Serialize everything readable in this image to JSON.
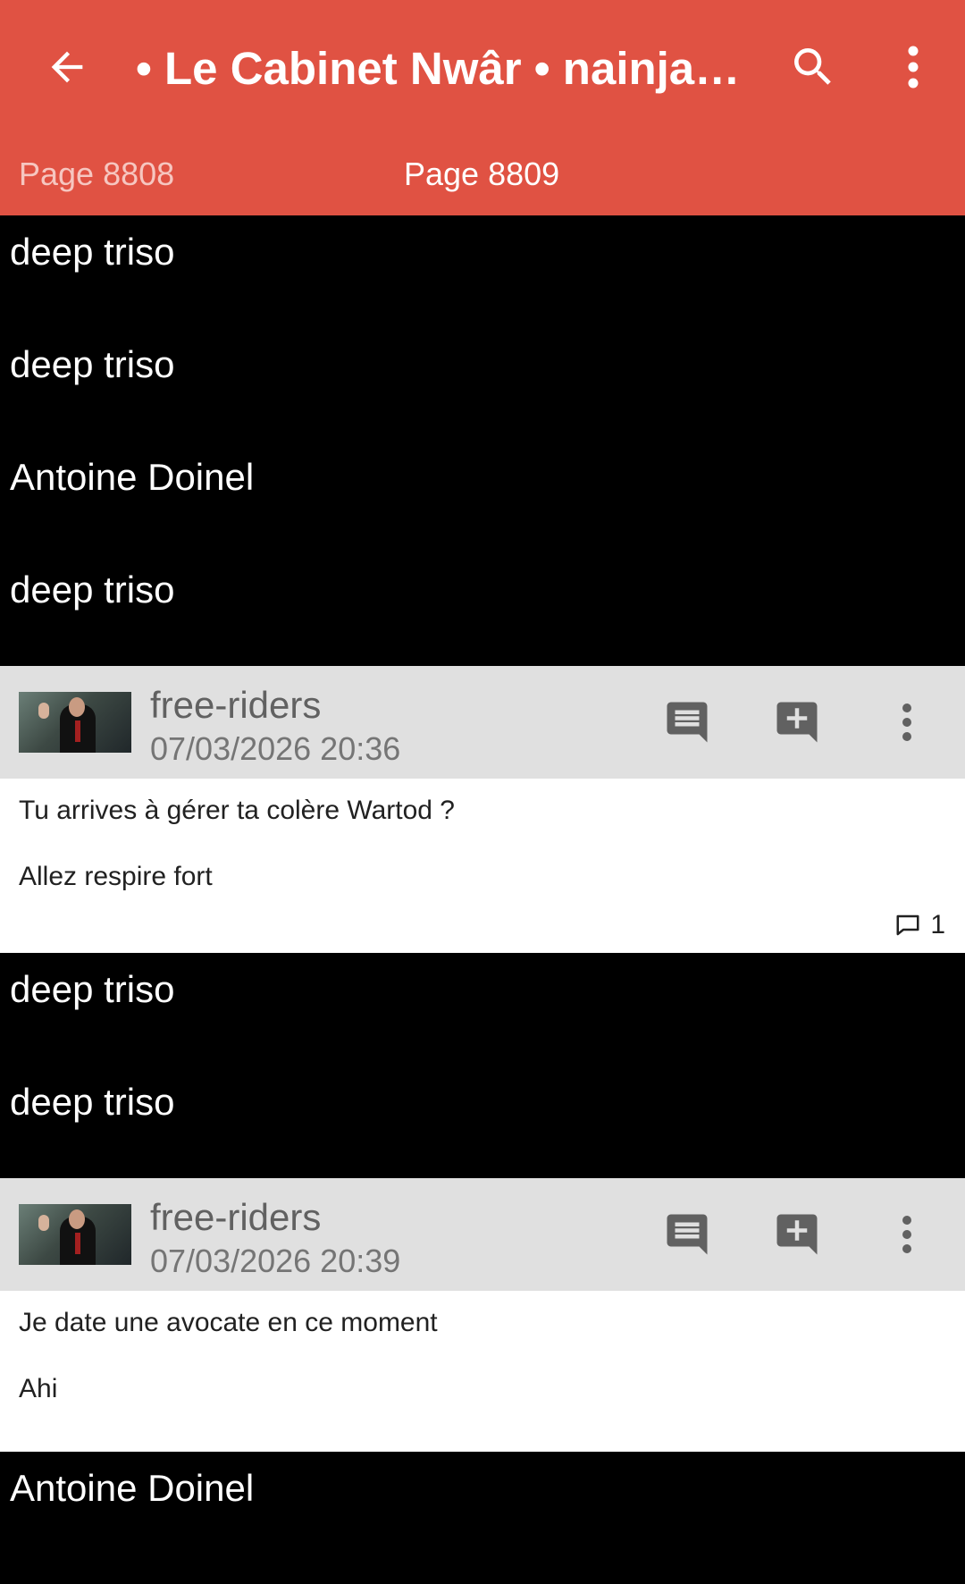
{
  "toolbar": {
    "title": "• Le Cabinet Nwâr • nainjau…",
    "back_icon": "arrow-back-icon",
    "search_icon": "search-icon",
    "menu_icon": "more-vert-icon"
  },
  "tabs": {
    "previous": "Page 8808",
    "current": "Page 8809"
  },
  "colors": {
    "appbar": "#e05243",
    "ignored_bg": "#000000",
    "post_header_bg": "#e0e0e0"
  },
  "feed": {
    "ignored_top": [
      "deep triso",
      "deep triso",
      "Antoine Doinel",
      "deep triso"
    ],
    "post1": {
      "author": "free-riders",
      "date": "07/03/2026 20:36",
      "lines": [
        "Tu arrives à gérer ta colère Wartod ?",
        "Allez respire fort"
      ],
      "reply_count": "1"
    },
    "ignored_middle": [
      "deep triso",
      "deep triso"
    ],
    "post2": {
      "author": "free-riders",
      "date": "07/03/2026 20:39",
      "lines": [
        "Je date une avocate en ce moment",
        "Ahi"
      ]
    },
    "ignored_bottom": [
      "Antoine Doinel"
    ]
  }
}
